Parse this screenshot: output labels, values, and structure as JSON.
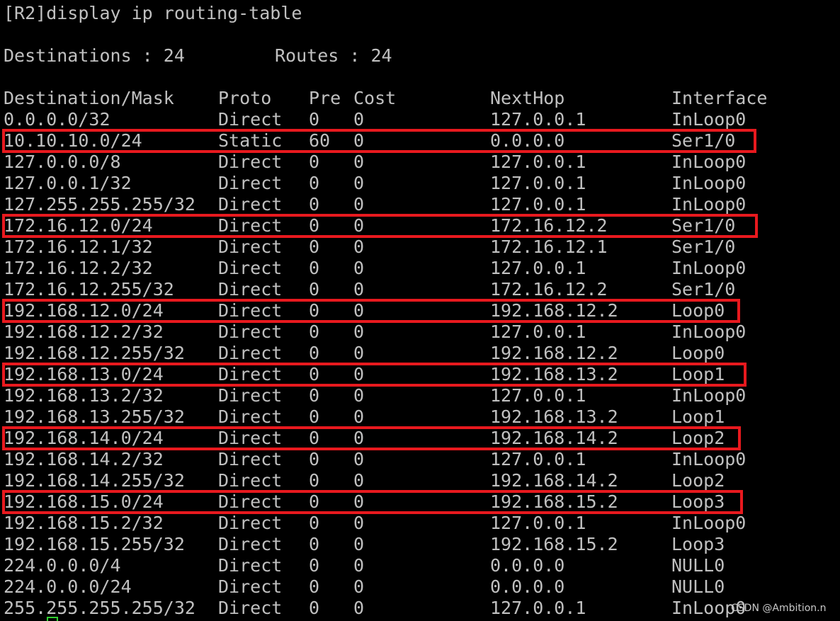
{
  "terminal": {
    "command_line": "[R2]display ip routing-table",
    "summary": {
      "destinations_label": "Destinations : 24",
      "routes_label": "Routes : 24"
    },
    "table": {
      "headers": {
        "destination": "Destination/Mask",
        "proto": "Proto",
        "pre": "Pre",
        "cost": "Cost",
        "nexthop": "NextHop",
        "interface": "Interface"
      },
      "rows": [
        {
          "destination": "0.0.0.0/32",
          "proto": "Direct",
          "pre": "0",
          "cost": "0",
          "nexthop": "127.0.0.1",
          "interface": "InLoop0",
          "highlighted": false
        },
        {
          "destination": "10.10.10.0/24",
          "proto": "Static",
          "pre": "60",
          "cost": "0",
          "nexthop": "0.0.0.0",
          "interface": "Ser1/0",
          "highlighted": true
        },
        {
          "destination": "127.0.0.0/8",
          "proto": "Direct",
          "pre": "0",
          "cost": "0",
          "nexthop": "127.0.0.1",
          "interface": "InLoop0",
          "highlighted": false
        },
        {
          "destination": "127.0.0.1/32",
          "proto": "Direct",
          "pre": "0",
          "cost": "0",
          "nexthop": "127.0.0.1",
          "interface": "InLoop0",
          "highlighted": false
        },
        {
          "destination": "127.255.255.255/32",
          "proto": "Direct",
          "pre": "0",
          "cost": "0",
          "nexthop": "127.0.0.1",
          "interface": "InLoop0",
          "highlighted": false
        },
        {
          "destination": "172.16.12.0/24",
          "proto": "Direct",
          "pre": "0",
          "cost": "0",
          "nexthop": "172.16.12.2",
          "interface": "Ser1/0",
          "highlighted": true
        },
        {
          "destination": "172.16.12.1/32",
          "proto": "Direct",
          "pre": "0",
          "cost": "0",
          "nexthop": "172.16.12.1",
          "interface": "Ser1/0",
          "highlighted": false
        },
        {
          "destination": "172.16.12.2/32",
          "proto": "Direct",
          "pre": "0",
          "cost": "0",
          "nexthop": "127.0.0.1",
          "interface": "InLoop0",
          "highlighted": false
        },
        {
          "destination": "172.16.12.255/32",
          "proto": "Direct",
          "pre": "0",
          "cost": "0",
          "nexthop": "172.16.12.2",
          "interface": "Ser1/0",
          "highlighted": false
        },
        {
          "destination": "192.168.12.0/24",
          "proto": "Direct",
          "pre": "0",
          "cost": "0",
          "nexthop": "192.168.12.2",
          "interface": "Loop0",
          "highlighted": true
        },
        {
          "destination": "192.168.12.2/32",
          "proto": "Direct",
          "pre": "0",
          "cost": "0",
          "nexthop": "127.0.0.1",
          "interface": "InLoop0",
          "highlighted": false
        },
        {
          "destination": "192.168.12.255/32",
          "proto": "Direct",
          "pre": "0",
          "cost": "0",
          "nexthop": "192.168.12.2",
          "interface": "Loop0",
          "highlighted": false
        },
        {
          "destination": "192.168.13.0/24",
          "proto": "Direct",
          "pre": "0",
          "cost": "0",
          "nexthop": "192.168.13.2",
          "interface": "Loop1",
          "highlighted": true
        },
        {
          "destination": "192.168.13.2/32",
          "proto": "Direct",
          "pre": "0",
          "cost": "0",
          "nexthop": "127.0.0.1",
          "interface": "InLoop0",
          "highlighted": false
        },
        {
          "destination": "192.168.13.255/32",
          "proto": "Direct",
          "pre": "0",
          "cost": "0",
          "nexthop": "192.168.13.2",
          "interface": "Loop1",
          "highlighted": false
        },
        {
          "destination": "192.168.14.0/24",
          "proto": "Direct",
          "pre": "0",
          "cost": "0",
          "nexthop": "192.168.14.2",
          "interface": "Loop2",
          "highlighted": true
        },
        {
          "destination": "192.168.14.2/32",
          "proto": "Direct",
          "pre": "0",
          "cost": "0",
          "nexthop": "127.0.0.1",
          "interface": "InLoop0",
          "highlighted": false
        },
        {
          "destination": "192.168.14.255/32",
          "proto": "Direct",
          "pre": "0",
          "cost": "0",
          "nexthop": "192.168.14.2",
          "interface": "Loop2",
          "highlighted": false
        },
        {
          "destination": "192.168.15.0/24",
          "proto": "Direct",
          "pre": "0",
          "cost": "0",
          "nexthop": "192.168.15.2",
          "interface": "Loop3",
          "highlighted": true
        },
        {
          "destination": "192.168.15.2/32",
          "proto": "Direct",
          "pre": "0",
          "cost": "0",
          "nexthop": "127.0.0.1",
          "interface": "InLoop0",
          "highlighted": false
        },
        {
          "destination": "192.168.15.255/32",
          "proto": "Direct",
          "pre": "0",
          "cost": "0",
          "nexthop": "192.168.15.2",
          "interface": "Loop3",
          "highlighted": false
        },
        {
          "destination": "224.0.0.0/4",
          "proto": "Direct",
          "pre": "0",
          "cost": "0",
          "nexthop": "0.0.0.0",
          "interface": "NULL0",
          "highlighted": false
        },
        {
          "destination": "224.0.0.0/24",
          "proto": "Direct",
          "pre": "0",
          "cost": "0",
          "nexthop": "0.0.0.0",
          "interface": "NULL0",
          "highlighted": false
        },
        {
          "destination": "255.255.255.255/32",
          "proto": "Direct",
          "pre": "0",
          "cost": "0",
          "nexthop": "127.0.0.1",
          "interface": "InLoop0",
          "highlighted": false
        }
      ]
    }
  },
  "watermark": "CSDN @Ambition.n",
  "colors": {
    "background": "#000000",
    "text": "#c0c0c0",
    "highlight_border": "#e8191e",
    "cursor": "#2fd12f"
  }
}
